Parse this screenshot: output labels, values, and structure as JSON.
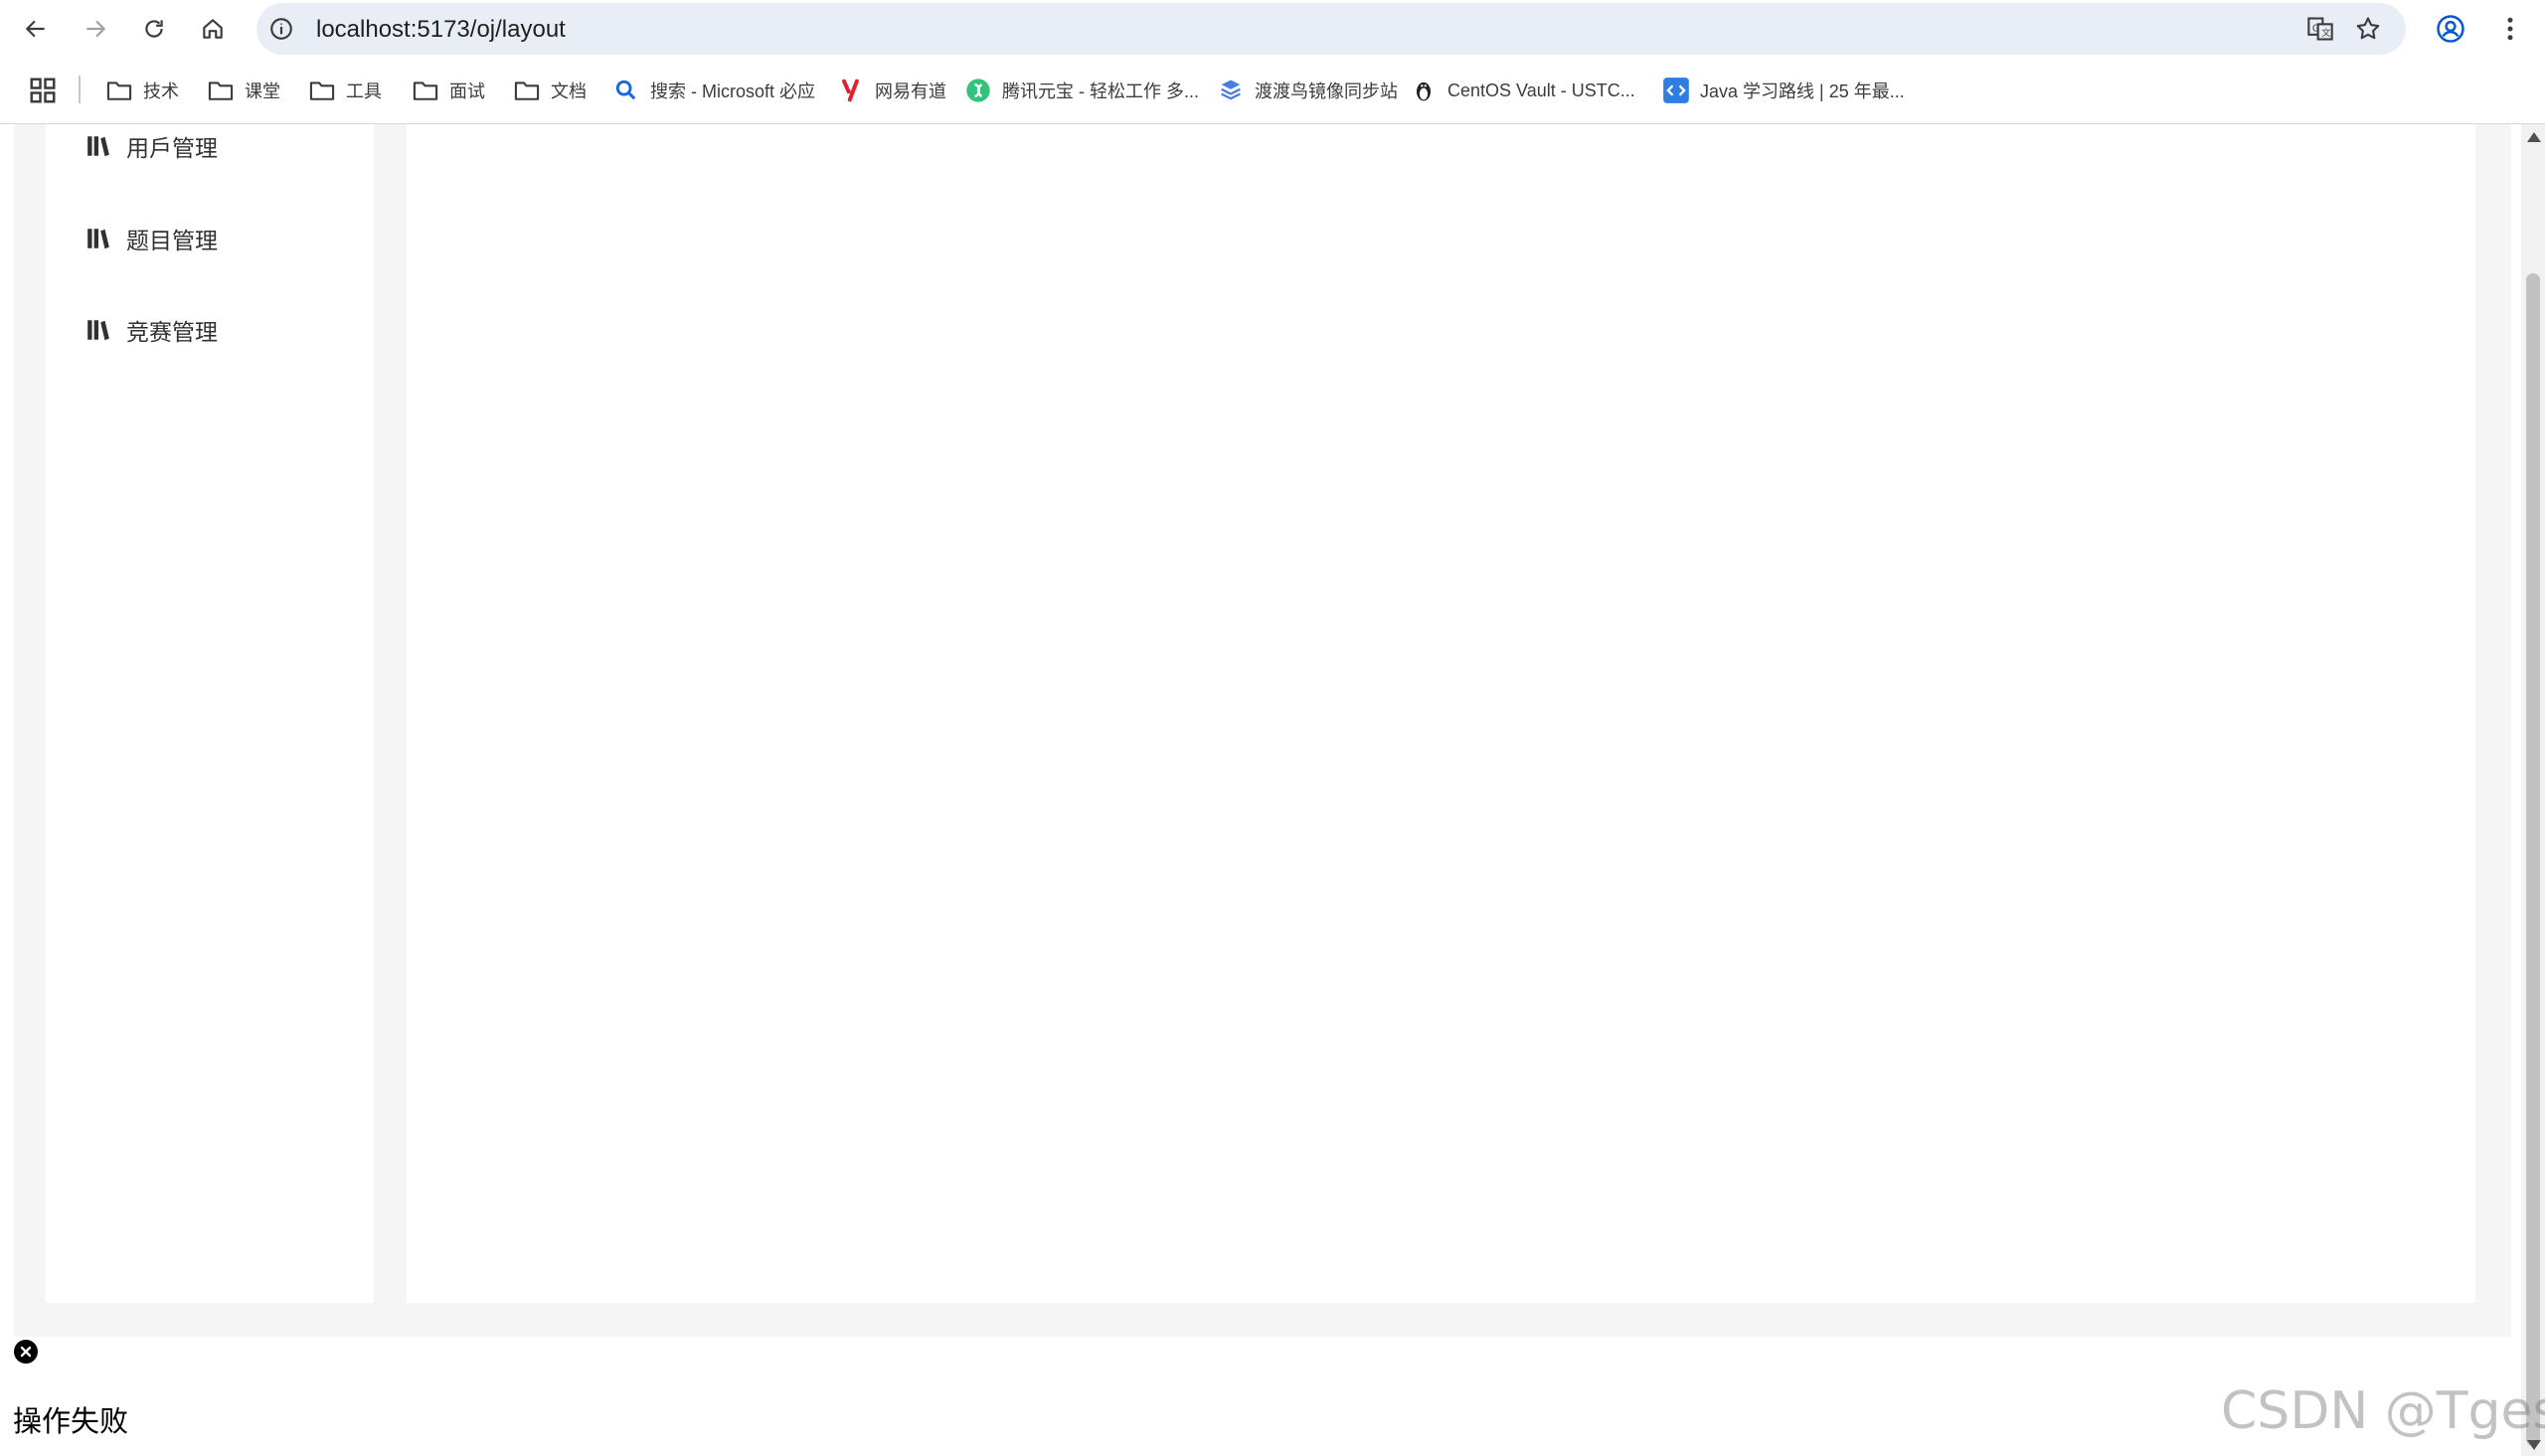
{
  "browser": {
    "url": "localhost:5173/oj/layout",
    "bookmarks": [
      {
        "label": "技术",
        "icon": "folder-icon"
      },
      {
        "label": "课堂",
        "icon": "folder-icon"
      },
      {
        "label": "工具",
        "icon": "folder-icon"
      },
      {
        "label": "面试",
        "icon": "folder-icon"
      },
      {
        "label": "文档",
        "icon": "folder-icon"
      },
      {
        "label": "搜索 - Microsoft 必应",
        "icon": "bing-search-icon"
      },
      {
        "label": "网易有道",
        "icon": "youdao-icon"
      },
      {
        "label": "腾讯元宝 - 轻松工作 多...",
        "icon": "yuanbao-icon"
      },
      {
        "label": "渡渡鸟镜像同步站",
        "icon": "dodo-mirror-icon"
      },
      {
        "label": "CentOS Vault - USTC...",
        "icon": "penguin-icon"
      },
      {
        "label": "Java 学习路线 | 25 年最...",
        "icon": "code-icon"
      }
    ]
  },
  "sidebar": {
    "items": [
      {
        "label": "用戶管理",
        "icon": "book-icon"
      },
      {
        "label": "题目管理",
        "icon": "book-icon"
      },
      {
        "label": "竞赛管理",
        "icon": "book-icon"
      }
    ]
  },
  "message": {
    "text": "操作失败"
  },
  "watermark": "CSDN @Tgess",
  "colors": {
    "page_background": "#f5f5f5",
    "omnibox": "#e9eef6",
    "panel": "#ffffff"
  }
}
